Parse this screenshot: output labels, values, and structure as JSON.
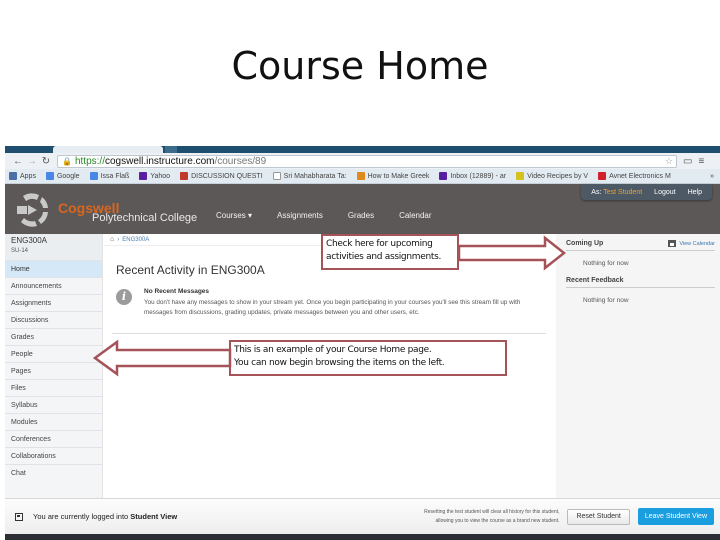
{
  "slide": {
    "title": "Course Home"
  },
  "browser": {
    "url_scheme": "https://",
    "url_host": "cogswell.instructure.com",
    "url_path": "/courses/89",
    "bookmarks": [
      {
        "label": "Apps",
        "icon": "apps-grid-icon",
        "color": "#4a6fa5"
      },
      {
        "label": "Google",
        "icon": "google-icon",
        "color": "#4a86e8"
      },
      {
        "label": "Issa Flaß",
        "icon": "bookmark-icon",
        "color": "#4a86e8"
      },
      {
        "label": "Yahoo",
        "icon": "yahoo-icon",
        "color": "#5a1ea0"
      },
      {
        "label": "DISCUSSION QUESTI",
        "icon": "discussion-icon",
        "color": "#c0392b"
      },
      {
        "label": "Sri Mahabharata Ta:",
        "icon": "page-icon",
        "color": "#ffffff"
      },
      {
        "label": "How to Make Greek",
        "icon": "recipe-icon",
        "color": "#e08a1e"
      },
      {
        "label": "Inbox (12889) - ar",
        "icon": "yahoo-mail-icon",
        "color": "#5a1ea0"
      },
      {
        "label": "Video Recipes by V",
        "icon": "video-icon",
        "color": "#d6c21e"
      },
      {
        "label": "Avnet Electronics M",
        "icon": "avnet-icon",
        "color": "#d0202a"
      }
    ]
  },
  "header": {
    "brand_line1": "Cogswell",
    "brand_line2": "Polytechnical College",
    "nav": [
      "Courses ▾",
      "Assignments",
      "Grades",
      "Calendar"
    ],
    "user_prefix": "As:",
    "user_name": "Test Student",
    "logout": "Logout",
    "help": "Help"
  },
  "sidebar": {
    "course_code": "ENG300A",
    "term": "SU-14",
    "items": [
      {
        "label": "Home",
        "active": true
      },
      {
        "label": "Announcements"
      },
      {
        "label": "Assignments"
      },
      {
        "label": "Discussions"
      },
      {
        "label": "Grades"
      },
      {
        "label": "People"
      },
      {
        "label": "Pages"
      },
      {
        "label": "Files"
      },
      {
        "label": "Syllabus"
      },
      {
        "label": "Modules"
      },
      {
        "label": "Conferences"
      },
      {
        "label": "Collaborations"
      },
      {
        "label": "Chat"
      }
    ]
  },
  "main": {
    "breadcrumb": "ENG300A",
    "title": "Recent Activity in ENG300A",
    "stream_header": "No Recent Messages",
    "stream_body": "You don't have any messages to show in your stream yet. Once you begin participating in your courses you'll see this stream fill up with messages from discussions, grading updates, private messages between you and other users, etc."
  },
  "right": {
    "coming_up": "Coming Up",
    "view_calendar": "View Calendar",
    "coming_up_empty": "Nothing for now",
    "recent_feedback": "Recent Feedback",
    "feedback_empty": "Nothing for now"
  },
  "footer": {
    "status_prefix": "You are currently logged into ",
    "status_bold": "Student View",
    "reset_note_1": "Resetting the test student will clear all history for this student,",
    "reset_note_2": "allowing you to view the course as a brand new student.",
    "reset_button": "Reset Student",
    "leave_button": "Leave Student View"
  },
  "callouts": {
    "upcoming": "Check here for upcoming activities and assignments.",
    "course_home_1": "This is an example of your Course Home page.",
    "course_home_2": "You can now begin browsing the items on the left."
  },
  "colors": {
    "callout_border": "#a55358",
    "header_bg": "#5c5857",
    "brand_orange": "#d9661f",
    "primary_button": "#1a9ee0",
    "active_nav": "#d5e8f7"
  }
}
